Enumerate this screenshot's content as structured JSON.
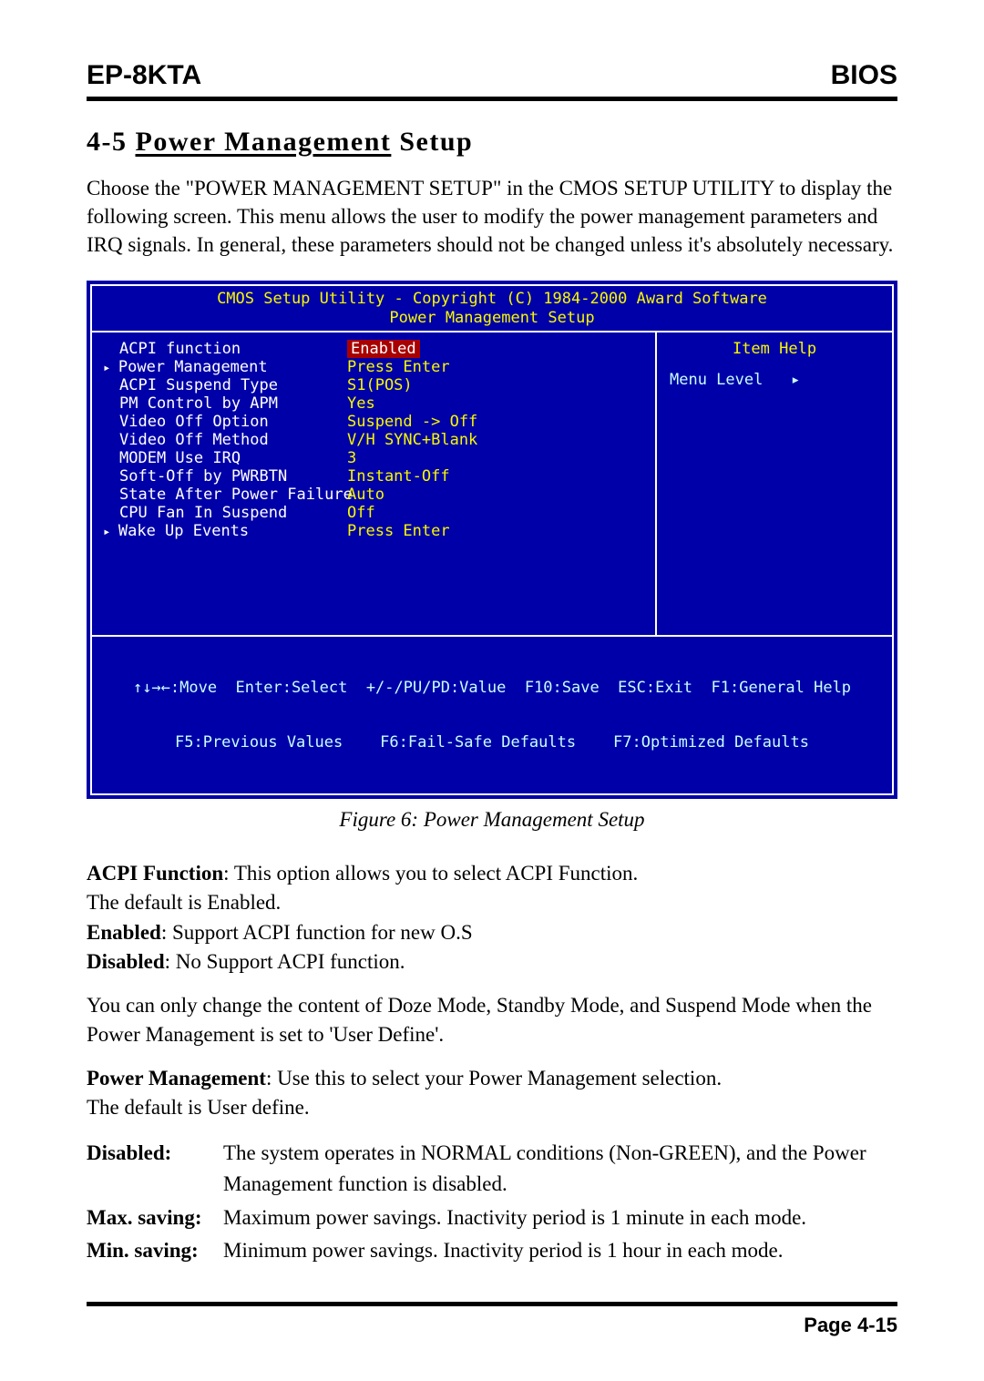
{
  "header": {
    "left": "EP-8KTA",
    "right": "BIOS"
  },
  "section": {
    "num": "4-5",
    "title_underlined": "Power Management",
    "title_rest": "Setup"
  },
  "intro": "Choose the \"POWER MANAGEMENT SETUP\" in the CMOS SETUP UTILITY to display the following screen. This menu allows the user to modify the power management parameters and IRQ signals. In general, these parameters should not be changed unless it's absolutely necessary.",
  "bios": {
    "title": "CMOS Setup Utility - Copyright (C) 1984-2000 Award Software",
    "subtitle": "Power Management Setup",
    "items": [
      {
        "label": "ACPI function",
        "value": "Enabled",
        "selected": true,
        "marker": false
      },
      {
        "label": "Power Management",
        "value": "Press Enter",
        "selected": false,
        "marker": true
      },
      {
        "label": "ACPI Suspend Type",
        "value": "S1(POS)",
        "selected": false,
        "marker": false
      },
      {
        "label": "PM Control by APM",
        "value": "Yes",
        "selected": false,
        "marker": false
      },
      {
        "label": "Video Off Option",
        "value": "Suspend -> Off",
        "selected": false,
        "marker": false
      },
      {
        "label": "Video Off Method",
        "value": "V/H SYNC+Blank",
        "selected": false,
        "marker": false
      },
      {
        "label": "MODEM Use IRQ",
        "value": "3",
        "selected": false,
        "marker": false
      },
      {
        "label": "Soft-Off by PWRBTN",
        "value": "Instant-Off",
        "selected": false,
        "marker": false
      },
      {
        "label": "State After Power Failure",
        "value": "Auto",
        "selected": false,
        "marker": false
      },
      {
        "label": "CPU Fan In Suspend",
        "value": "Off",
        "selected": false,
        "marker": false
      },
      {
        "label": "Wake Up Events",
        "value": "Press Enter",
        "selected": false,
        "marker": true
      }
    ],
    "help_title": "Item Help",
    "help_content": "Menu Level   ▸",
    "footer_line1": "↑↓→←:Move  Enter:Select  +/-/PU/PD:Value  F10:Save  ESC:Exit  F1:General Help",
    "footer_line2": "F5:Previous Values    F6:Fail-Safe Defaults    F7:Optimized Defaults"
  },
  "figure_caption": "Figure 6:  Power Management Setup",
  "blocks": {
    "acpi": {
      "name": "ACPI Function",
      "desc": ": This option allows you to select ACPI Function.",
      "line2": "The default is Enabled.",
      "enabled_label": "Enabled",
      "enabled_desc": ":  Support ACPI function for new O.S",
      "disabled_label": "Disabled",
      "disabled_desc": ": No Support ACPI function."
    },
    "note": "You can only change the content of Doze Mode, Standby Mode, and Suspend Mode when the Power Management is set to 'User Define'.",
    "pm": {
      "name": "Power Management",
      "desc": ": Use this to select your Power Management selection.",
      "line2": "The default is User define."
    }
  },
  "defs": [
    {
      "term": "Disabled:",
      "text": "The system operates in NORMAL conditions (Non-GREEN), and the Power Management function is disabled."
    },
    {
      "term": "Max. saving:",
      "text": "Maximum power savings. Inactivity period is 1 minute in each mode."
    },
    {
      "term": "Min. saving:",
      "text": "Minimum power savings. Inactivity period is 1 hour in each mode."
    }
  ],
  "page_num": "Page 4-15"
}
